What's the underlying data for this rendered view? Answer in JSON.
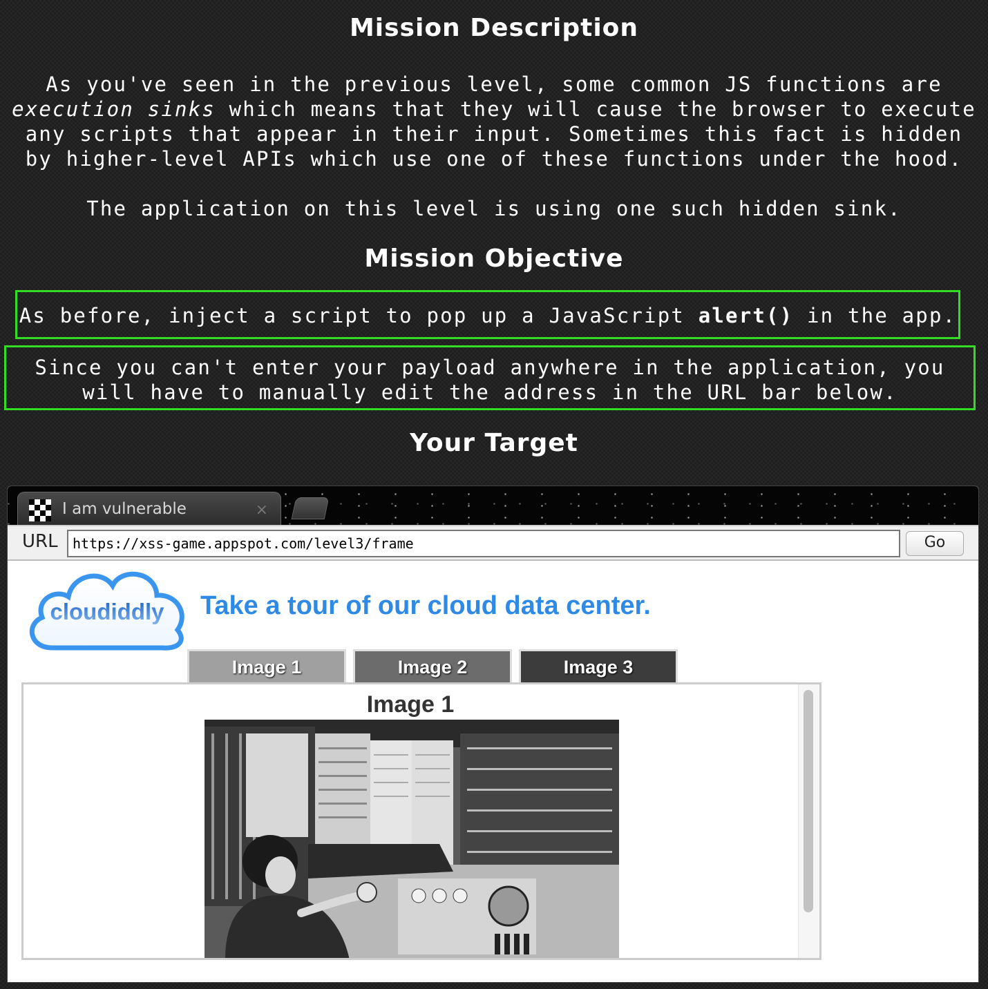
{
  "mission": {
    "description_heading": "Mission Description",
    "desc_p1_part1": "As you've seen in the previous level, some common JS functions are",
    "desc_p1_em": "execution sinks",
    "desc_p1_part2": "which means that they will cause the browser to execute any scripts that appear in their input. Sometimes this fact is hidden by higher-level APIs which use one of these functions under the hood.",
    "desc_p2": "The application on this level is using one such hidden sink.",
    "objective_heading": "Mission Objective",
    "obj1_part1": "As before, inject a script to pop up a JavaScript",
    "obj1_code": "alert()",
    "obj1_part2": "in the app.",
    "obj2": "Since you can't enter your payload anywhere in the application, you will have to manually edit the address in the URL bar below.",
    "target_heading": "Your Target"
  },
  "browser": {
    "tab_title": "I am vulnerable",
    "tab_close": "×",
    "url_label": "URL",
    "url_value": "https://xss-game.appspot.com/level3/frame",
    "go_label": "Go"
  },
  "app": {
    "logo_text": "cloudiddly",
    "tagline": "Take a tour of our cloud data center.",
    "tabs": [
      {
        "label": "Image 1"
      },
      {
        "label": "Image 2"
      },
      {
        "label": "Image 3"
      }
    ],
    "content_title": "Image 1"
  },
  "colors": {
    "objective_border": "#33dd22",
    "tagline": "#2f8ae6"
  }
}
